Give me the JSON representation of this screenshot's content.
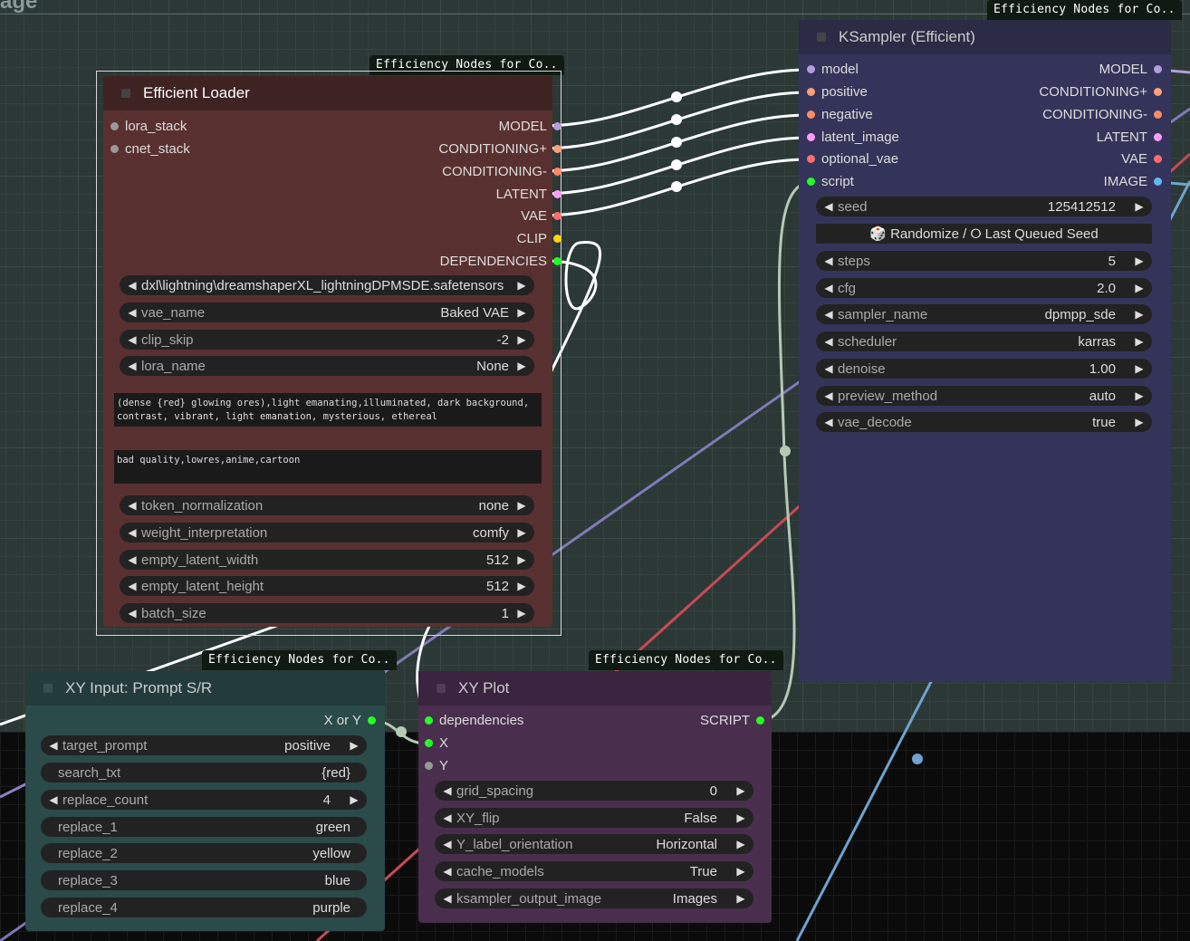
{
  "group_title_fragment": "age",
  "badge_text": "Efficiency Nodes for Co..",
  "efficient_loader": {
    "title": "Efficient Loader",
    "inputs": [
      "lora_stack",
      "cnet_stack"
    ],
    "outputs": [
      "MODEL",
      "CONDITIONING+",
      "CONDITIONING-",
      "LATENT",
      "VAE",
      "CLIP",
      "DEPENDENCIES"
    ],
    "ckpt_name": "dxl\\lightning\\dreamshaperXL_lightningDPMSDE.safetensors",
    "widgets": [
      {
        "label": "vae_name",
        "value": "Baked VAE"
      },
      {
        "label": "clip_skip",
        "value": "-2"
      },
      {
        "label": "lora_name",
        "value": "None"
      }
    ],
    "positive_prompt": "(dense {red} glowing ores),light emanating,illuminated, dark background,\ncontrast, vibrant, light emanation, mysterious, ethereal",
    "negative_prompt": "bad quality,lowres,anime,cartoon",
    "widgets2": [
      {
        "label": "token_normalization",
        "value": "none"
      },
      {
        "label": "weight_interpretation",
        "value": "comfy"
      },
      {
        "label": "empty_latent_width",
        "value": "512"
      },
      {
        "label": "empty_latent_height",
        "value": "512"
      },
      {
        "label": "batch_size",
        "value": "1"
      }
    ]
  },
  "ksampler": {
    "title": "KSampler (Efficient)",
    "inputs": [
      "model",
      "positive",
      "negative",
      "latent_image",
      "optional_vae",
      "script"
    ],
    "outputs": [
      "MODEL",
      "CONDITIONING+",
      "CONDITIONING-",
      "LATENT",
      "VAE",
      "IMAGE"
    ],
    "seed": {
      "label": "seed",
      "value": "125412512"
    },
    "seed_button": "🎲 Randomize / ⭘ Last Queued Seed",
    "widgets": [
      {
        "label": "steps",
        "value": "5"
      },
      {
        "label": "cfg",
        "value": "2.0"
      },
      {
        "label": "sampler_name",
        "value": "dpmpp_sde"
      },
      {
        "label": "scheduler",
        "value": "karras"
      },
      {
        "label": "denoise",
        "value": "1.00"
      },
      {
        "label": "preview_method",
        "value": "auto"
      },
      {
        "label": "vae_decode",
        "value": "true"
      }
    ]
  },
  "xy_input": {
    "title": "XY Input: Prompt S/R",
    "output": "X or Y",
    "target_prompt": {
      "label": "target_prompt",
      "value": "positive"
    },
    "search_txt": {
      "label": "search_txt",
      "value": "{red}"
    },
    "replace_count": {
      "label": "replace_count",
      "value": "4"
    },
    "replaces": [
      {
        "label": "replace_1",
        "value": "green"
      },
      {
        "label": "replace_2",
        "value": "yellow"
      },
      {
        "label": "replace_3",
        "value": "blue"
      },
      {
        "label": "replace_4",
        "value": "purple"
      }
    ]
  },
  "xy_plot": {
    "title": "XY Plot",
    "inputs": [
      "dependencies",
      "X",
      "Y"
    ],
    "output": "SCRIPT",
    "widgets": [
      {
        "label": "grid_spacing",
        "value": "0"
      },
      {
        "label": "XY_flip",
        "value": "False"
      },
      {
        "label": "Y_label_orientation",
        "value": "Horizontal"
      },
      {
        "label": "cache_models",
        "value": "True"
      },
      {
        "label": "ksampler_output_image",
        "value": "Images"
      }
    ]
  },
  "colors": {
    "model": "#b39ddb",
    "conditioning": "#ffa07a",
    "conditioning_neg": "#ff8a65",
    "latent": "#ff9cf9",
    "vae": "#ff6e6e",
    "clip": "#ffd500",
    "image": "#64b5f6",
    "script": "#22ff22",
    "generic": "#999999"
  }
}
